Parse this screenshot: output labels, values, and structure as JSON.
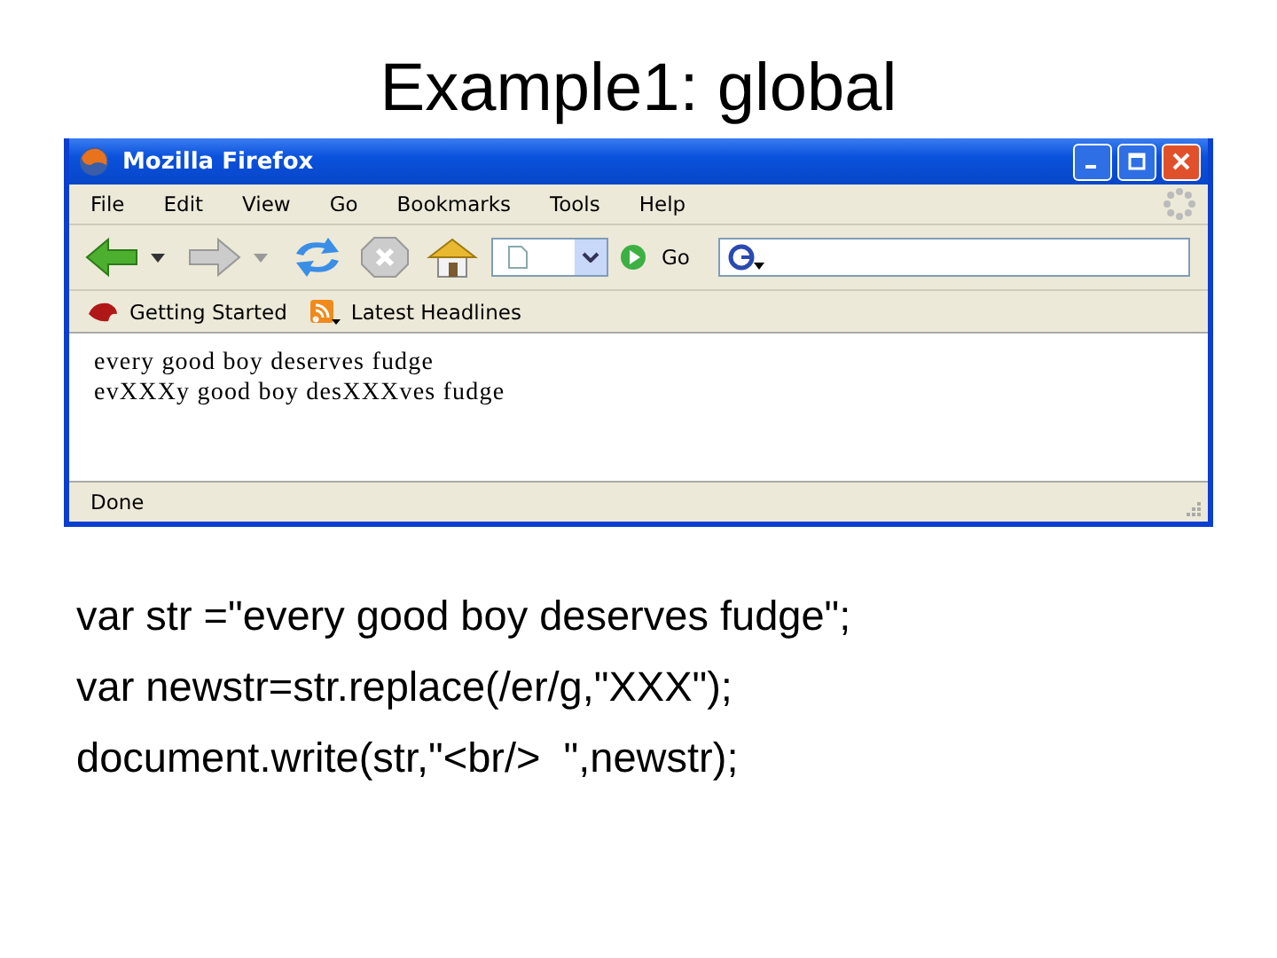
{
  "slide_title": "Example1: global",
  "window": {
    "title": "Mozilla Firefox"
  },
  "menu": [
    "File",
    "Edit",
    "View",
    "Go",
    "Bookmarks",
    "Tools",
    "Help"
  ],
  "toolbar": {
    "go_label": "Go"
  },
  "bookmarks": [
    {
      "label": "Getting Started",
      "kind": "page"
    },
    {
      "label": "Latest Headlines",
      "kind": "feed"
    }
  ],
  "content_lines": [
    "every good boy deserves fudge",
    "evXXXy good boy desXXXves fudge"
  ],
  "status": "Done",
  "code_lines": [
    "var str =\"every good boy deserves fudge\";",
    "var newstr=str.replace(/er/g,\"XXX\");",
    "document.write(str,\"<br/>  \",newstr);"
  ]
}
